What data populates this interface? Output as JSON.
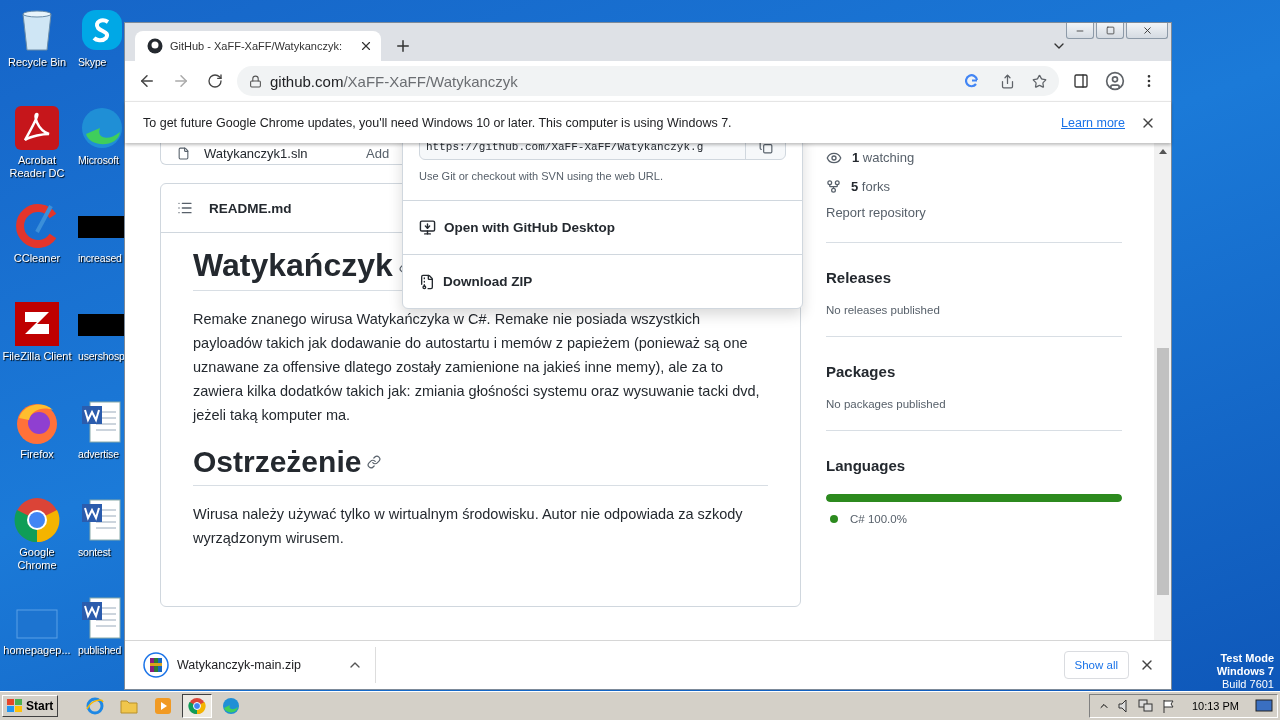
{
  "desktop": {
    "columns": [
      [
        {
          "label": "Recycle Bin",
          "kind": "recycle"
        },
        {
          "label": "Acrobat Reader DC",
          "kind": "pdf"
        },
        {
          "label": "CCleaner",
          "kind": "ccleaner"
        },
        {
          "label": "FileZilla Client",
          "kind": "filezilla"
        },
        {
          "label": "Firefox",
          "kind": "firefox"
        },
        {
          "label": "Google Chrome",
          "kind": "chrome"
        },
        {
          "label": "homepagep...",
          "kind": "blank"
        }
      ],
      [
        {
          "label": "Skype",
          "kind": "skype"
        },
        {
          "label": "Microsoft",
          "kind": "edge"
        },
        {
          "label": "increased",
          "kind": "black"
        },
        {
          "label": "usershosp",
          "kind": "black"
        },
        {
          "label": "advertise",
          "kind": "word"
        },
        {
          "label": "sontest",
          "kind": "word"
        },
        {
          "label": "published",
          "kind": "word"
        }
      ]
    ],
    "test_mode": [
      "Test Mode",
      "Windows 7",
      "Build 7601"
    ]
  },
  "browser": {
    "tab": {
      "title": "GitHub - XaFF-XaFF/Watykanczyk:",
      "selected": true
    },
    "address": {
      "domain": "github.com",
      "path": "/XaFF-XaFF/Watykanczyk"
    },
    "infobar": {
      "message": "To get future Google Chrome updates, you'll need Windows 10 or later. This computer is using Windows 7.",
      "link": "Learn more"
    }
  },
  "file_row": {
    "name": "Watykanczyk1.sln",
    "message": "Add"
  },
  "readme": {
    "filename": "README.md",
    "sections": [
      {
        "heading": "Watykańczyk",
        "paragraph": "Remake znanego wirusa Watykańczyka w C#. Remake nie posiada wszystkich payloadów takich jak dodawanie do autostartu i memów z papieżem (ponieważ są one uznawane za offensive dlatego zostały zamienione na jakieś inne memy), ale za to zawiera kilka dodatków takich jak: zmiania głośności systemu oraz wysuwanie tacki dvd, jeżeli taką komputer ma."
      },
      {
        "heading": "Ostrzeżenie",
        "paragraph": "Wirusa należy używać tylko w wirtualnym środowisku. Autor nie odpowiada za szkody wyrządzonym wirusem."
      }
    ]
  },
  "clone_menu": {
    "url": "https://github.com/XaFF-XaFF/Watykanczyk.g",
    "hint": "Use Git or checkout with SVN using the web URL.",
    "items": [
      {
        "label": "Open with GitHub Desktop",
        "kind": "desktop"
      },
      {
        "label": "Download ZIP",
        "kind": "zip"
      }
    ]
  },
  "sidebar": {
    "stats": [
      {
        "kind": "watch",
        "count": "1",
        "label": "watching"
      },
      {
        "kind": "fork",
        "count": "5",
        "label": "forks"
      }
    ],
    "report": "Report repository",
    "sections": [
      {
        "title": "Releases",
        "note": "No releases published"
      },
      {
        "title": "Packages",
        "note": "No packages published"
      }
    ],
    "languages": {
      "title": "Languages",
      "items": [
        {
          "name": "C#",
          "percent": "100.0%",
          "color": "#2c8a1e",
          "level": 1
        }
      ]
    }
  },
  "download": {
    "file": "Watykanczyk-main.zip",
    "show_all": "Show all"
  },
  "taskbar": {
    "start": "Start",
    "apps": [
      {
        "kind": "ie",
        "selected": false
      },
      {
        "kind": "explorer",
        "selected": false
      },
      {
        "kind": "media",
        "selected": false
      },
      {
        "kind": "chrome",
        "selected": true
      },
      {
        "kind": "edge",
        "selected": false
      }
    ],
    "clock": "10:13 PM"
  }
}
